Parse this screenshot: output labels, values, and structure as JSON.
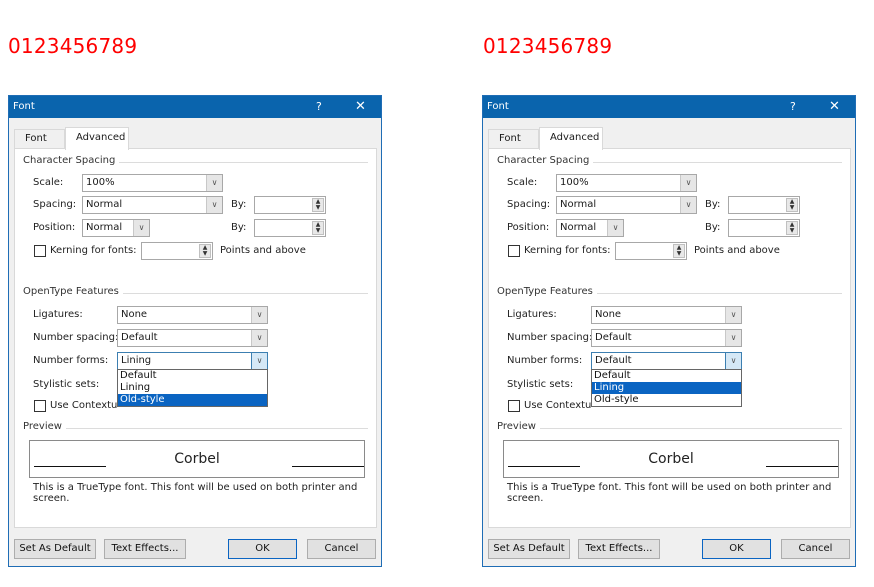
{
  "sample_digits": {
    "left": "0123456789",
    "right": "0123456789",
    "color": "#ff0000"
  },
  "dialogs": [
    {
      "title": "Font",
      "help_label": "?",
      "close_label": "✕",
      "tabs": [
        {
          "label": "Font"
        },
        {
          "label": "Advanced",
          "active": true
        }
      ],
      "character_spacing": {
        "heading": "Character Spacing",
        "scale_label": "Scale:",
        "scale_value": "100%",
        "spacing_label": "Spacing:",
        "spacing_value": "Normal",
        "spacing_by_label": "By:",
        "spacing_by_value": "",
        "position_label": "Position:",
        "position_value": "Normal",
        "position_by_label": "By:",
        "position_by_value": "",
        "kerning_label": "Kerning for fonts:",
        "kerning_checked": false,
        "kerning_value": "",
        "kerning_suffix": "Points and above"
      },
      "opentype": {
        "heading": "OpenType Features",
        "ligatures_label": "Ligatures:",
        "ligatures_value": "None",
        "number_spacing_label": "Number spacing:",
        "number_spacing_value": "Default",
        "number_forms_label": "Number forms:",
        "number_forms_value": "Lining",
        "stylistic_sets_label": "Stylistic sets:",
        "contextual_label": "Use Contextual Alternates",
        "contextual_checked": false,
        "number_forms_options": [
          "Default",
          "Lining",
          "Old-style"
        ],
        "highlighted_option": "Old-style"
      },
      "preview": {
        "heading": "Preview",
        "sample": "Corbel",
        "note": "This is a TrueType font. This font will be used on both printer and screen."
      },
      "buttons": {
        "set_default": "Set As Default",
        "text_effects": "Text Effects...",
        "ok": "OK",
        "cancel": "Cancel"
      }
    },
    {
      "title": "Font",
      "help_label": "?",
      "close_label": "✕",
      "tabs": [
        {
          "label": "Font"
        },
        {
          "label": "Advanced",
          "active": true
        }
      ],
      "character_spacing": {
        "heading": "Character Spacing",
        "scale_label": "Scale:",
        "scale_value": "100%",
        "spacing_label": "Spacing:",
        "spacing_value": "Normal",
        "spacing_by_label": "By:",
        "spacing_by_value": "",
        "position_label": "Position:",
        "position_value": "Normal",
        "position_by_label": "By:",
        "position_by_value": "",
        "kerning_label": "Kerning for fonts:",
        "kerning_checked": false,
        "kerning_value": "",
        "kerning_suffix": "Points and above"
      },
      "opentype": {
        "heading": "OpenType Features",
        "ligatures_label": "Ligatures:",
        "ligatures_value": "None",
        "number_spacing_label": "Number spacing:",
        "number_spacing_value": "Default",
        "number_forms_label": "Number forms:",
        "number_forms_value": "Default",
        "stylistic_sets_label": "Stylistic sets:",
        "contextual_label": "Use Contextual Alternates",
        "contextual_checked": false,
        "number_forms_options": [
          "Default",
          "Lining",
          "Old-style"
        ],
        "highlighted_option": "Lining"
      },
      "preview": {
        "heading": "Preview",
        "sample": "Corbel",
        "note": "This is a TrueType font. This font will be used on both printer and screen."
      },
      "buttons": {
        "set_default": "Set As Default",
        "text_effects": "Text Effects...",
        "ok": "OK",
        "cancel": "Cancel"
      }
    }
  ]
}
